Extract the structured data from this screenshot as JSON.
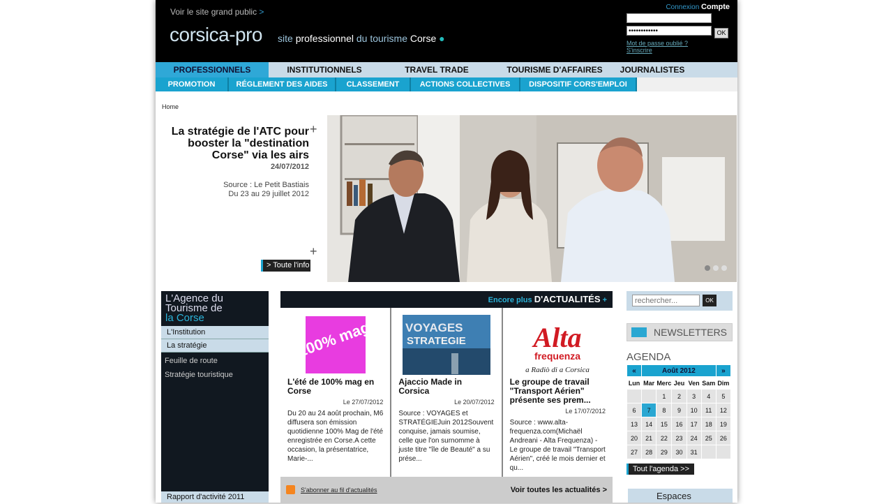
{
  "header": {
    "voir_link": "Voir le site grand public",
    "voir_arrow": ">",
    "logo": "corsica-pro",
    "tagline_1": "site",
    "tagline_2": "professionnel",
    "tagline_3": "du tourisme",
    "tagline_4": "Corse",
    "login": {
      "title_small": "Connexion",
      "title_big": "Compte",
      "username_value": "",
      "password_value": "••••••••••••",
      "ok_label": "OK",
      "forgot": "Mot de passe oublié ?",
      "register": "S'inscrire"
    }
  },
  "nav_primary": [
    "PROFESSIONNELS",
    "INSTITUTIONNELS",
    "TRAVEL TRADE",
    "TOURISME D'AFFAIRES",
    "JOURNALISTES"
  ],
  "nav_secondary": [
    "PROMOTION",
    "RÉGLEMENT DES AIDES",
    "CLASSEMENT",
    "ACTIONS COLLECTIVES",
    "DISPOSITIF CORS'EMPLOI"
  ],
  "breadcrumb": "Home",
  "featured": {
    "title": "La stratégie de l'ATC pour booster la \"destination Corse\" via les airs",
    "date": "24/07/2012",
    "source_1": "Source : Le Petit Bastiais",
    "source_2": "Du 23 au 29 juillet 2012",
    "more_button": "> Toute l'info",
    "plus": "+"
  },
  "sidebar": {
    "title_1": "L'Agence du",
    "title_2": "Tourisme de",
    "title_3": "la Corse",
    "items": [
      "L'Institution",
      "La stratégie"
    ],
    "subitems": [
      "Feuille de route",
      "Stratégie touristique"
    ],
    "footer": "Rapport d'activité 2011"
  },
  "news": {
    "header_small": "Encore plus",
    "header_big": "D'ACTUALITÉS",
    "header_plus": "+",
    "articles": [
      {
        "title": "L'été de 100% mag en Corse",
        "date": "Le 27/07/2012",
        "text": "Du 20 au 24 août prochain, M6 diffusera son émission quotidienne 100% Mag de l'été enregistrée en Corse.A cette occasion, la présentatrice, Marie-...",
        "img_text": "100% mag"
      },
      {
        "title": "Ajaccio Made in Corsica",
        "date": "Le 20/07/2012",
        "text": "Source : VOYAGES et STRATÉGIEJuin 2012Souvent conquise, jamais soumise, celle que l'on surnomme à juste titre \"île de Beauté\" a su prése...",
        "img_text_1": "VOYAGES",
        "img_text_2": "STRATEGIE"
      },
      {
        "title": "Le groupe de travail \"Transport Aérien\" présente ses prem...",
        "date": "Le 17/07/2012",
        "text": "Source : www.alta-frequenza.com(Michaël Andreani - Alta Frequenza) - Le groupe de travail \"Transport Aérien\", créé le mois dernier et qu...",
        "img_text_1": "Alta",
        "img_text_2": "frequenza",
        "img_text_3": "a Radiò di a Corsica"
      }
    ],
    "rss_label": "S'abonner au fil d'actualités",
    "see_all": "Voir toutes les actualités >"
  },
  "right": {
    "search_placeholder": "rechercher...",
    "search_ok": "OK",
    "newsletters": "NEWSLETTERS",
    "agenda_title": "AGENDA",
    "calendar": {
      "prev": "«",
      "month": "Août 2012",
      "next": "»",
      "weekdays": [
        "Lun",
        "Mar",
        "Merc",
        "Jeu",
        "Ven",
        "Sam",
        "Dim"
      ],
      "weeks": [
        [
          "",
          "",
          "1",
          "2",
          "3",
          "4",
          "5"
        ],
        [
          "6",
          "7",
          "8",
          "9",
          "10",
          "11",
          "12"
        ],
        [
          "13",
          "14",
          "15",
          "16",
          "17",
          "18",
          "19"
        ],
        [
          "20",
          "21",
          "22",
          "23",
          "24",
          "25",
          "26"
        ],
        [
          "27",
          "28",
          "29",
          "30",
          "31",
          "",
          ""
        ]
      ],
      "today": "7"
    },
    "agenda_button": "Tout l'agenda >>",
    "espaces": "Espaces"
  },
  "colors": {
    "accent": "#1aa3cf",
    "nav_bg": "#c9dbe8",
    "dark": "#111820"
  }
}
